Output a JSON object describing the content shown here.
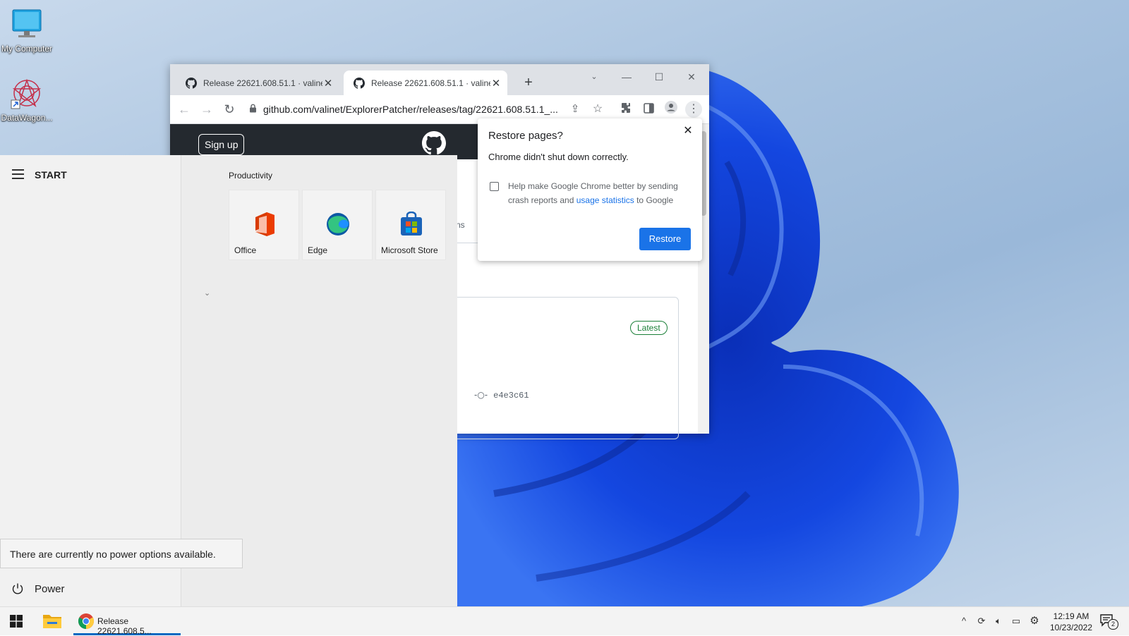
{
  "desktop": {
    "icons": [
      {
        "label": "My Computer",
        "icon": "monitor-icon"
      },
      {
        "label": "DataWagon...",
        "icon": "datawagon-icon"
      }
    ]
  },
  "chrome": {
    "tabs": [
      {
        "title": "Release 22621.608.51.1 · valinet/",
        "active": false
      },
      {
        "title": "Release 22621.608.51.1 · valinet/",
        "active": true
      }
    ],
    "new_tab_glyph": "+",
    "url": "github.com/valinet/ExplorerPatcher/releases/tag/22621.608.51.1_...",
    "page": {
      "signup_label": "Sign up",
      "tabs_fragment": "ns",
      "latest_badge": "Latest",
      "commit_hash": "e4e3c61"
    },
    "restore_dialog": {
      "title": "Restore pages?",
      "message": "Chrome didn't shut down correctly.",
      "checkbox_text_before": "Help make Google Chrome better by sending crash reports and ",
      "checkbox_link": "usage statistics",
      "checkbox_text_after": " to Google",
      "checkbox_checked": false,
      "button_label": "Restore",
      "accent": "#1a73e8"
    }
  },
  "start_menu": {
    "label": "START",
    "section_label": "Productivity",
    "tiles": [
      {
        "label": "Office",
        "icon": "office-icon"
      },
      {
        "label": "Edge",
        "icon": "edge-icon"
      },
      {
        "label": "Microsoft Store",
        "icon": "store-icon"
      }
    ],
    "power_tooltip": "There are currently no power options available.",
    "power_label": "Power"
  },
  "taskbar": {
    "chrome_window_label": "Release 22621.608.5...",
    "time": "12:19 AM",
    "date": "10/23/2022",
    "notification_count": "2",
    "accent": "#0067c0"
  }
}
